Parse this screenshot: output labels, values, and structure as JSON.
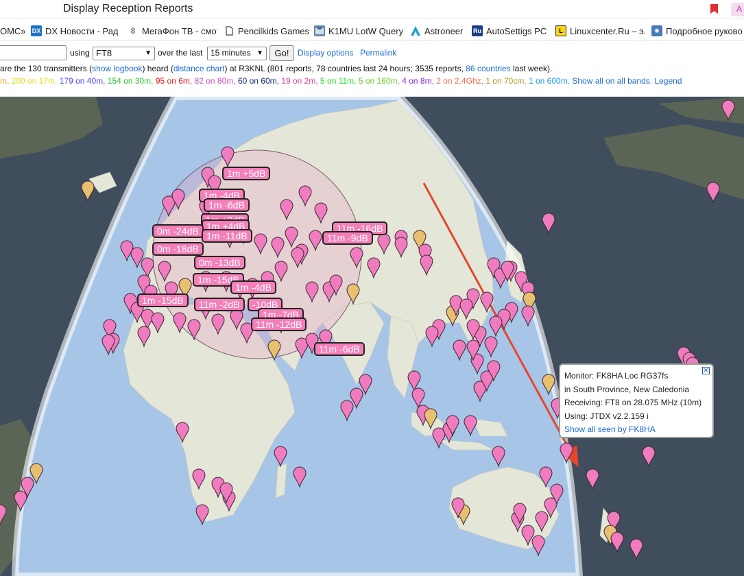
{
  "browser": {
    "page_title": "Display Reception Reports",
    "profile_badge": "A",
    "bookmarks": [
      {
        "label": "ОМС»",
        "icon": "none"
      },
      {
        "label": "DX Новости - Радио",
        "icon": "dx-icon",
        "color": "#1e73c8",
        "mark": "DX"
      },
      {
        "label": "МегаФон ТВ - смотр",
        "icon": "megafon-icon",
        "color": "#8a8a8a",
        "mark": "8"
      },
      {
        "label": "Pencilkids Games",
        "icon": "page-icon",
        "color": "#555555",
        "mark": ""
      },
      {
        "label": "K1MU LotW Query",
        "icon": "lotw-icon",
        "color": "#4a6a8a",
        "mark": ""
      },
      {
        "label": "Astroneer",
        "icon": "astroneer-icon",
        "color": "#1aa0d6",
        "mark": ""
      },
      {
        "label": "AutoSettigs PC",
        "icon": "ru-icon",
        "color": "#1d3f8a",
        "mark": "Ru"
      },
      {
        "label": "Linuxcenter.Ru – эл",
        "icon": "linuxcenter-icon",
        "color": "#f7d21a",
        "mark": "L"
      },
      {
        "label": "Подробное руково",
        "icon": "gear-icon",
        "color": "#4a7ab8",
        "mark": "✺"
      }
    ]
  },
  "controls": {
    "using_label": "using",
    "mode_value": "FT8",
    "over_label": "over the last",
    "period_value": "15 minutes",
    "go_label": "Go!",
    "display_options_label": "Display options",
    "permalink_label": "Permalink"
  },
  "summary": {
    "t1": "are the 130 transmitters (",
    "show_logbook": "show logbook",
    "t2": ") heard (",
    "distance_chart": "distance chart",
    "t3": ") at R3KNL (801 reports, 78 countries last 24 hours; 3535 reports, ",
    "countries_link": "86 countries",
    "t4": " last week)."
  },
  "bands": [
    {
      "text": "m",
      "color": "#e8a300"
    },
    {
      "text": "200 on 17m",
      "color": "#e2e01e"
    },
    {
      "text": "179 on 40m",
      "color": "#4747ff"
    },
    {
      "text": "154 on 30m",
      "color": "#2bc52b"
    },
    {
      "text": "95 on 6m",
      "color": "#e61a1a"
    },
    {
      "text": "82 on 80m",
      "color": "#d050d0"
    },
    {
      "text": "60 on 60m",
      "color": "#1a2a7a"
    },
    {
      "text": "19 on 2m",
      "color": "#e03aa0"
    },
    {
      "text": "5 on 11m",
      "color": "#22dd22"
    },
    {
      "text": "5 on 160m",
      "color": "#6ac82a"
    },
    {
      "text": "4 on 8m",
      "color": "#8a2be2"
    },
    {
      "text": "2 on 2.4Ghz",
      "color": "#ff6a4a"
    },
    {
      "text": "1 on 70cm",
      "color": "#a89a20"
    },
    {
      "text": "1 on 600m",
      "color": "#1a9ae8"
    }
  ],
  "band_links": {
    "show_all": "Show all on all bands.",
    "legend": "Legend"
  },
  "map": {
    "signal_labels": [
      "1m +5dB",
      "1m -4dB",
      "1m -6dB",
      "1m +2dB",
      "1m +4dB",
      "11m -16dB",
      "0m -24dB",
      "1m -11dB",
      "11m -9dB",
      "0m -18dB",
      "0m -13dB",
      "1m -15dB",
      "1m -4dB",
      "1m -15dB",
      "11m -2dB",
      "-10dB",
      "1m -7dB",
      "11m -12dB",
      "11m -6dB"
    ]
  },
  "info_window": {
    "monitor": "Monitor: FK8HA Loc RG37fs",
    "location": "in South Province, New Caledonia",
    "receiving": "Receiving: FT8 on 28.075 MHz (10m)",
    "using": "Using: JTDX v2.2.159 i",
    "show_all_link": "Show all seen by FK8HA"
  },
  "colors": {
    "pin": "#f07cbf",
    "label_bg": "#f57fb8",
    "ocean": "#a7c5e6",
    "land": "#e6e6da",
    "arrow": "#e8452e"
  }
}
